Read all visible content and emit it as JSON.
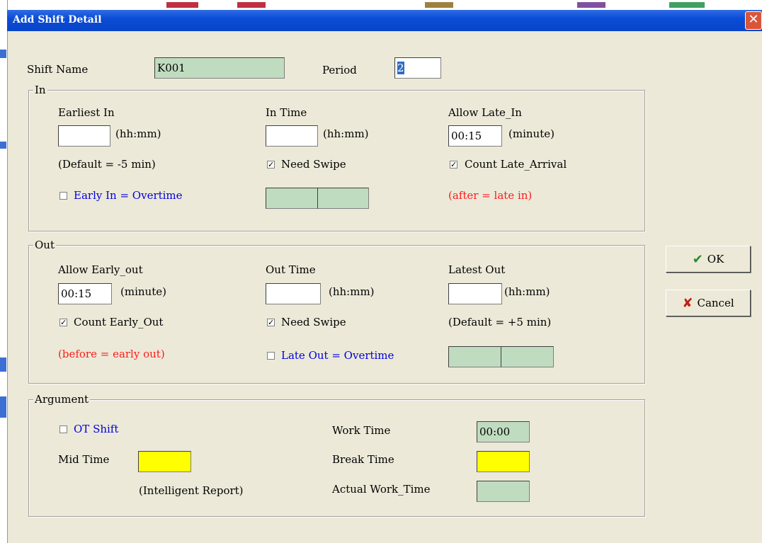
{
  "window": {
    "title": "Add Shift Detail",
    "close_glyph": "✕"
  },
  "header": {
    "shift_name_label": "Shift Name",
    "shift_name_value": "K001",
    "period_label": "Period",
    "period_value": "2"
  },
  "in_group": {
    "legend": "In",
    "earliest_in_label": "Earliest In",
    "earliest_in_value": "",
    "earliest_in_unit": "(hh:mm)",
    "earliest_in_note": "(Default = -5 min)",
    "early_in_ot_label": "Early In = Overtime",
    "early_in_ot_checked": false,
    "in_time_label": "In Time",
    "in_time_value": "",
    "in_time_unit": "(hh:mm)",
    "need_swipe_label": "Need Swipe",
    "need_swipe_checked": true,
    "allow_late_label": "Allow Late_In",
    "allow_late_value": "00:15",
    "allow_late_unit": "(minute)",
    "count_late_label": "Count Late_Arrival",
    "count_late_checked": true,
    "late_note": "(after = late in)"
  },
  "out_group": {
    "legend": "Out",
    "allow_early_label": "Allow Early_out",
    "allow_early_value": "00:15",
    "allow_early_unit": "(minute)",
    "count_early_label": "Count Early_Out",
    "count_early_checked": true,
    "early_note": "(before = early out)",
    "out_time_label": "Out Time",
    "out_time_value": "",
    "out_time_unit": "(hh:mm)",
    "need_swipe_label": "Need Swipe",
    "need_swipe_checked": true,
    "late_out_ot_label": "Late Out = Overtime",
    "late_out_ot_checked": false,
    "latest_out_label": "Latest Out",
    "latest_out_value": "",
    "latest_out_unit": "(hh:mm)",
    "latest_out_note": "(Default = +5 min)"
  },
  "argument_group": {
    "legend": "Argument",
    "ot_shift_label": "OT Shift",
    "ot_shift_checked": false,
    "mid_time_label": "Mid Time",
    "mid_time_value": "",
    "intelligent_report_label": "(Intelligent Report)",
    "work_time_label": "Work Time",
    "work_time_value": "00:00",
    "break_time_label": "Break Time",
    "break_time_value": "",
    "actual_work_label": "Actual Work_Time",
    "actual_work_value": ""
  },
  "buttons": {
    "ok_label": "OK",
    "ok_icon": "✔",
    "cancel_label": "Cancel",
    "cancel_icon": "✘"
  },
  "colors": {
    "titlebar": "#0b4cd6",
    "green_field": "#c0dcc0",
    "yellow_field": "#ffff00",
    "blue_text": "#0000dd",
    "red_text": "#ff1a1a"
  }
}
